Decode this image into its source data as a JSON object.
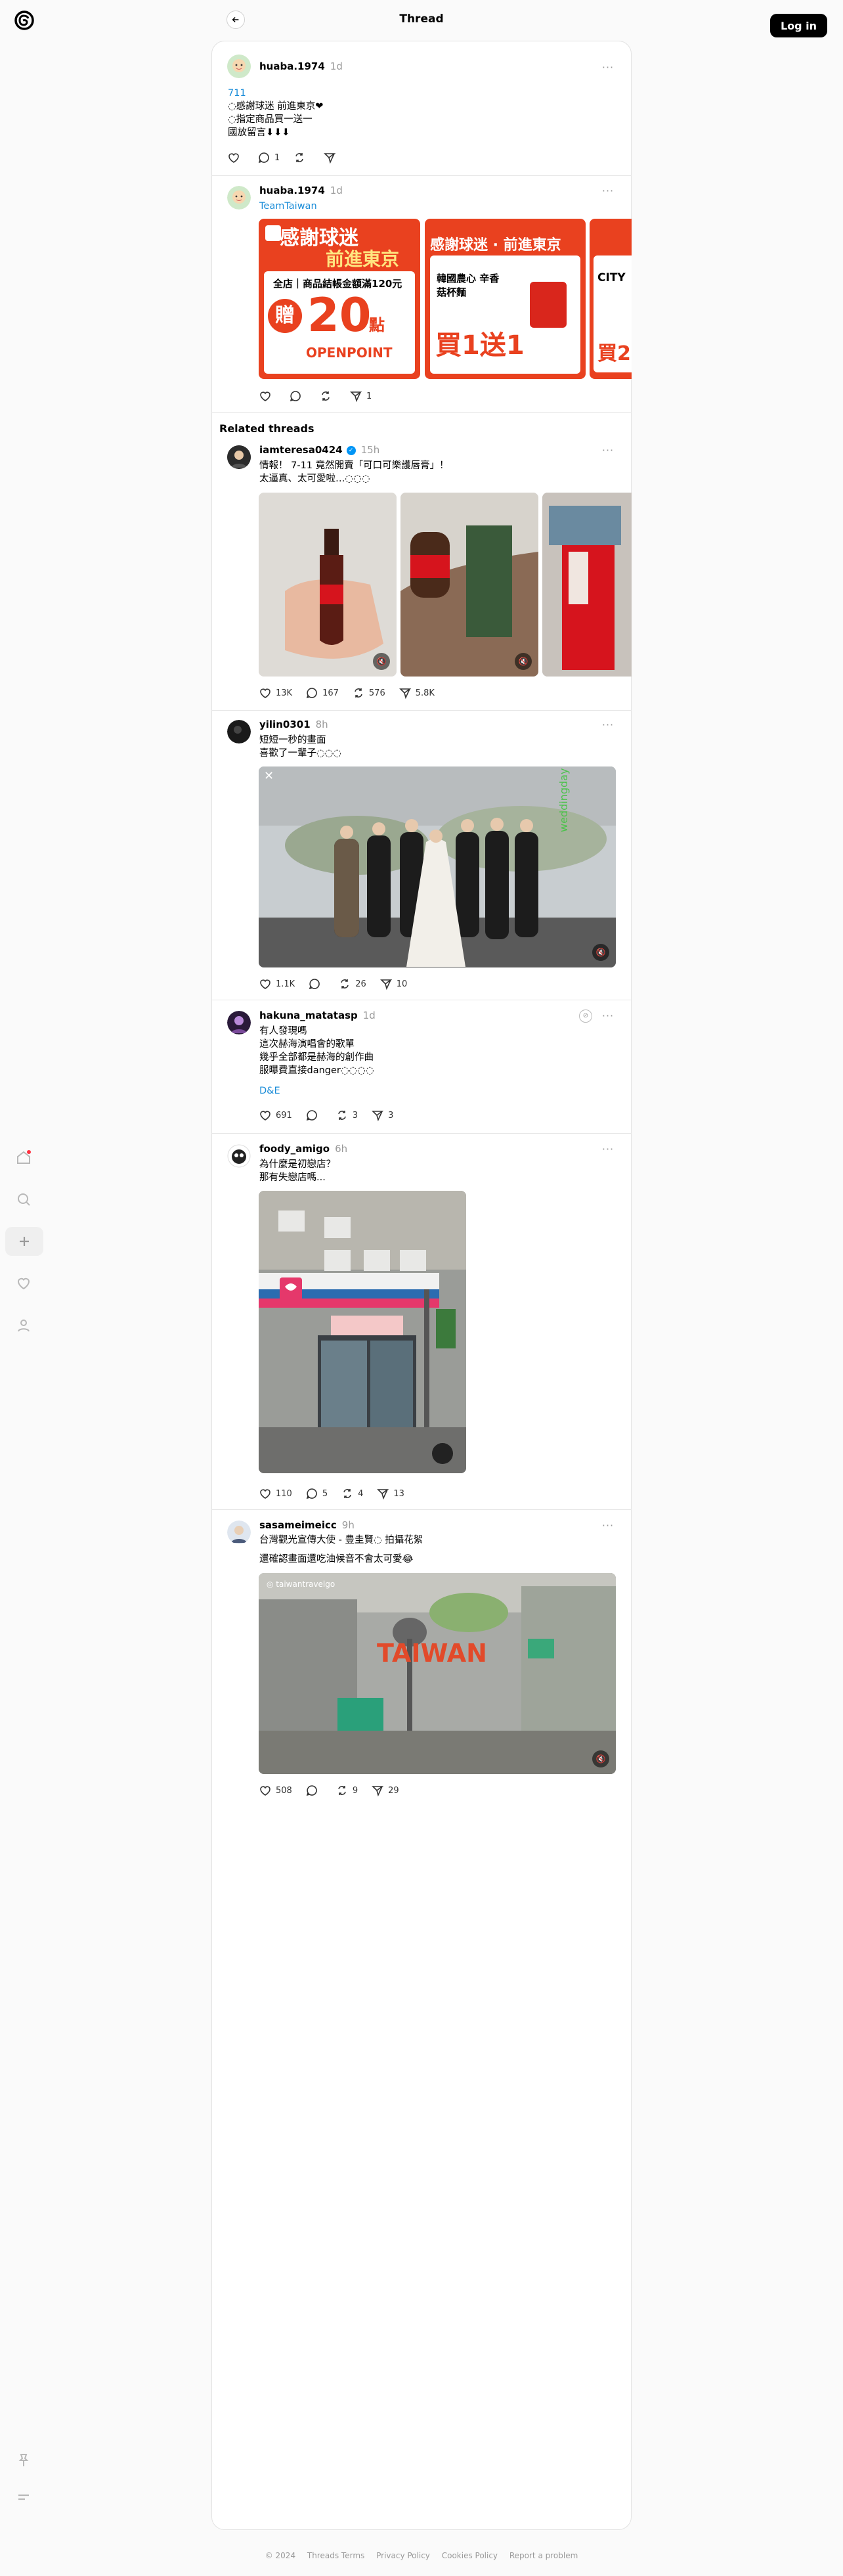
{
  "header": {
    "title": "Thread",
    "login_label": "Log in"
  },
  "icons": {
    "logo": "threads-logo-icon",
    "back": "arrow-left-icon",
    "more": "more-dots-icon"
  },
  "colors": {
    "accent_link": "#1a8cd8",
    "verified": "#0095f6",
    "login_bg": "#000000"
  },
  "post_main": {
    "username": "huaba.1974",
    "time": "1d",
    "lines": [
      "711",
      "◌感謝球迷 前進東京❤",
      "◌指定商品買一送一",
      "國放留言⬇⬇⬇"
    ],
    "likes": "",
    "replies": "1",
    "reposts": "",
    "shares": ""
  },
  "reply": {
    "username": "huaba.1974",
    "time": "1d",
    "mention": "TeamTaiwan",
    "promo1": {
      "top": "感謝球迷",
      "sub": "前進東京",
      "line": "全店｜商品結帳金額滿120元",
      "gift": "贈",
      "big": "20",
      "unit": "點",
      "brand": "OPENPOINT"
    },
    "promo2": {
      "top": "感謝球迷 · 前進東京",
      "product": "韓國農心 辛香菇杯麵",
      "deal": "買1送1"
    },
    "promo3": {
      "top": "CITY",
      "deal": "買2"
    },
    "likes": "",
    "replies": "",
    "reposts": "",
    "shares": "1"
  },
  "related": {
    "title": "Related threads",
    "posts": [
      {
        "username": "iamteresa0424",
        "time": "15h",
        "lines": [
          "情報！ 7-11 竟然開賣「可口可樂護唇膏」！",
          "太逼真、太可愛啦…◌◌◌"
        ],
        "link_word": "7-11",
        "likes": "13K",
        "replies": "167",
        "reposts": "576",
        "shares": "5.8K"
      },
      {
        "username": "yilin0301",
        "time": "8h",
        "lines": [
          "短短一秒的畫面",
          "喜歡了一輩子◌◌◌"
        ],
        "likes": "1.1K",
        "replies": "",
        "reposts": "26",
        "shares": "10"
      },
      {
        "username": "hakuna_matatasp",
        "time": "1d",
        "lines": [
          "有人發現嗎",
          "這次赫海演唱會的歌單",
          "幾乎全部都是赫海的創作曲",
          "服曝費直接danger◌◌◌◌"
        ],
        "tag": "D&E",
        "likes": "691",
        "replies": "",
        "reposts": "3",
        "shares": "3"
      },
      {
        "username": "foody_amigo",
        "time": "6h",
        "lines": [
          "為什麼是初戀店？",
          "那有失戀店嗎..."
        ],
        "likes": "110",
        "replies": "5",
        "reposts": "4",
        "shares": "13"
      },
      {
        "username": "sasameimeicc",
        "time": "9h",
        "lines": [
          "台灣觀光宣傳大使 - 豊圭賢◌ 拍攝花絮",
          "還確認畫面還吃油候音不會太可愛😂"
        ],
        "video_tag": "◎ taiwantravelgo",
        "video_title": "TAIWAN",
        "likes": "508",
        "replies": "",
        "reposts": "9",
        "shares": "29"
      }
    ]
  },
  "footer": [
    "© 2024",
    "Threads Terms",
    "Privacy Policy",
    "Cookies Policy",
    "Report a problem"
  ]
}
